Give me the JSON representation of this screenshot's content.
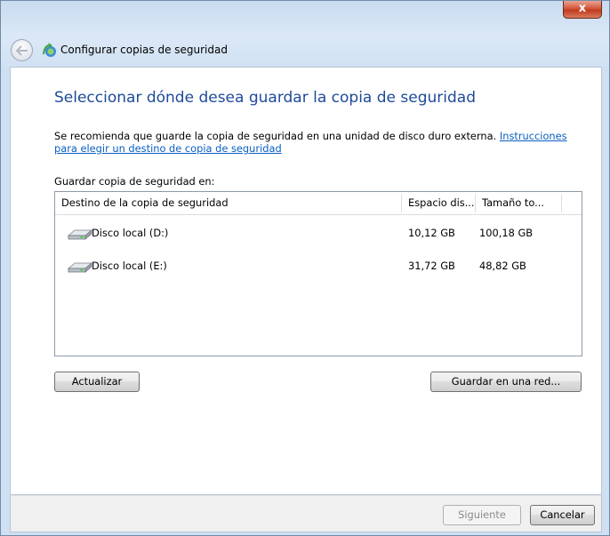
{
  "window": {
    "title": "Configurar copias de seguridad",
    "close_label": "x"
  },
  "page": {
    "heading": "Seleccionar dónde desea guardar la copia de seguridad",
    "description_prefix": "Se recomienda que guarde la copia de seguridad en una unidad de disco duro externa.",
    "link_text": "Instrucciones para elegir un destino de copia de seguridad",
    "save_label": "Guardar copia de seguridad en:"
  },
  "list": {
    "columns": [
      "Destino de la copia de seguridad",
      "Espacio dis...",
      "Tamaño to..."
    ],
    "rows": [
      {
        "name": "Disco local (D:)",
        "free": "10,12 GB",
        "total": "100,18 GB",
        "icon": "hard-drive-icon"
      },
      {
        "name": "Disco local (E:)",
        "free": "31,72 GB",
        "total": "48,82 GB",
        "icon": "hard-drive-icon"
      }
    ]
  },
  "buttons": {
    "refresh": "Actualizar",
    "save_network": "Guardar en una red...",
    "next": "Siguiente",
    "cancel": "Cancelar"
  },
  "colors": {
    "heading": "#1e4a99",
    "link": "#0a5fc2",
    "close": "#c13b1f"
  }
}
